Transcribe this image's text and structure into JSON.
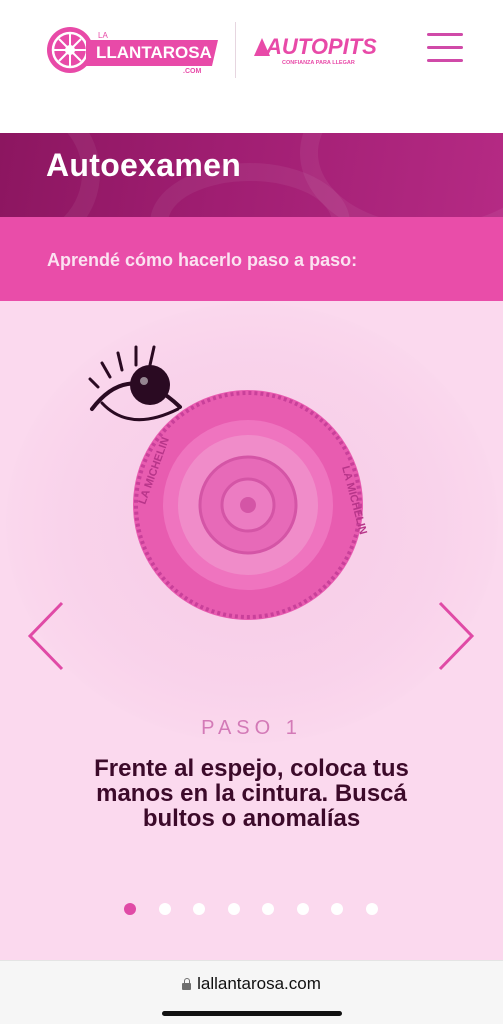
{
  "header": {
    "logo_llanta": {
      "small": "LA",
      "main": "LLANTAROSA",
      "suffix": ".COM"
    },
    "logo_autopits": {
      "main": "AUTOPITS",
      "tagline": "CONFIANZA PARA LLEGAR"
    }
  },
  "page": {
    "title": "Autoexamen",
    "subtitle": "Aprendé cómo hacerlo paso a paso:"
  },
  "carousel": {
    "step_label": "PASO 1",
    "step_text": "Frente al espejo, coloca tus manos en la cintura. Buscá bultos o anomalías",
    "tire_text": "LA MICHELIN",
    "slide_count": 8,
    "active_slide": 1
  },
  "browser": {
    "url": "lallantarosa.com"
  },
  "colors": {
    "brand_pink": "#e94da9",
    "title_band": "#a01e72",
    "carousel_bg": "#fbd9ee",
    "step_text": "#3c0a2a",
    "step_label": "#d37ab7"
  }
}
